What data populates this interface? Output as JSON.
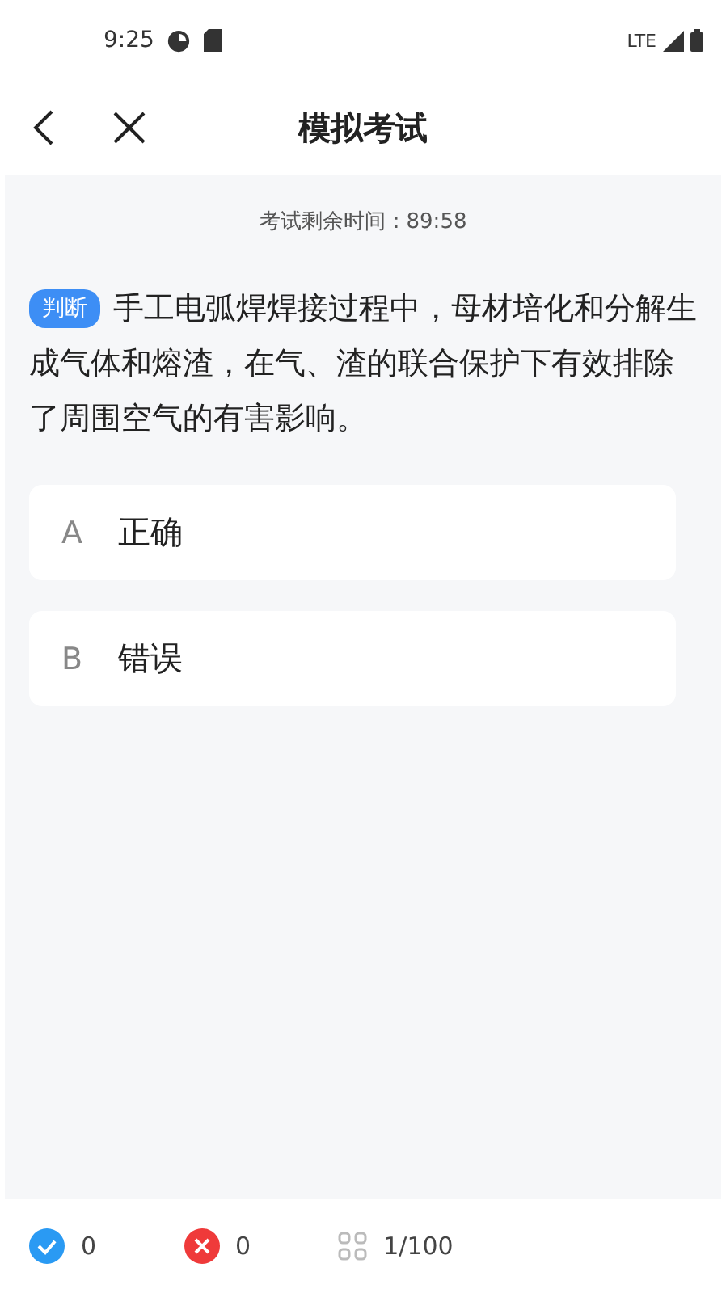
{
  "status_bar": {
    "time": "9:25",
    "network": "LTE"
  },
  "header": {
    "title": "模拟考试"
  },
  "timer": "考试剩余时间：89:58",
  "question": {
    "tag": "判断",
    "text": "手工电弧焊焊接过程中，母材培化和分解生成气体和熔渣，在气、渣的联合保护下有效排除了周围空气的有害影响。"
  },
  "options": [
    {
      "letter": "A",
      "text": "正确",
      "selected": false
    },
    {
      "letter": "B",
      "text": "错误",
      "selected": false
    }
  ],
  "footer": {
    "correct": "0",
    "wrong": "0",
    "progress": "1/100"
  }
}
